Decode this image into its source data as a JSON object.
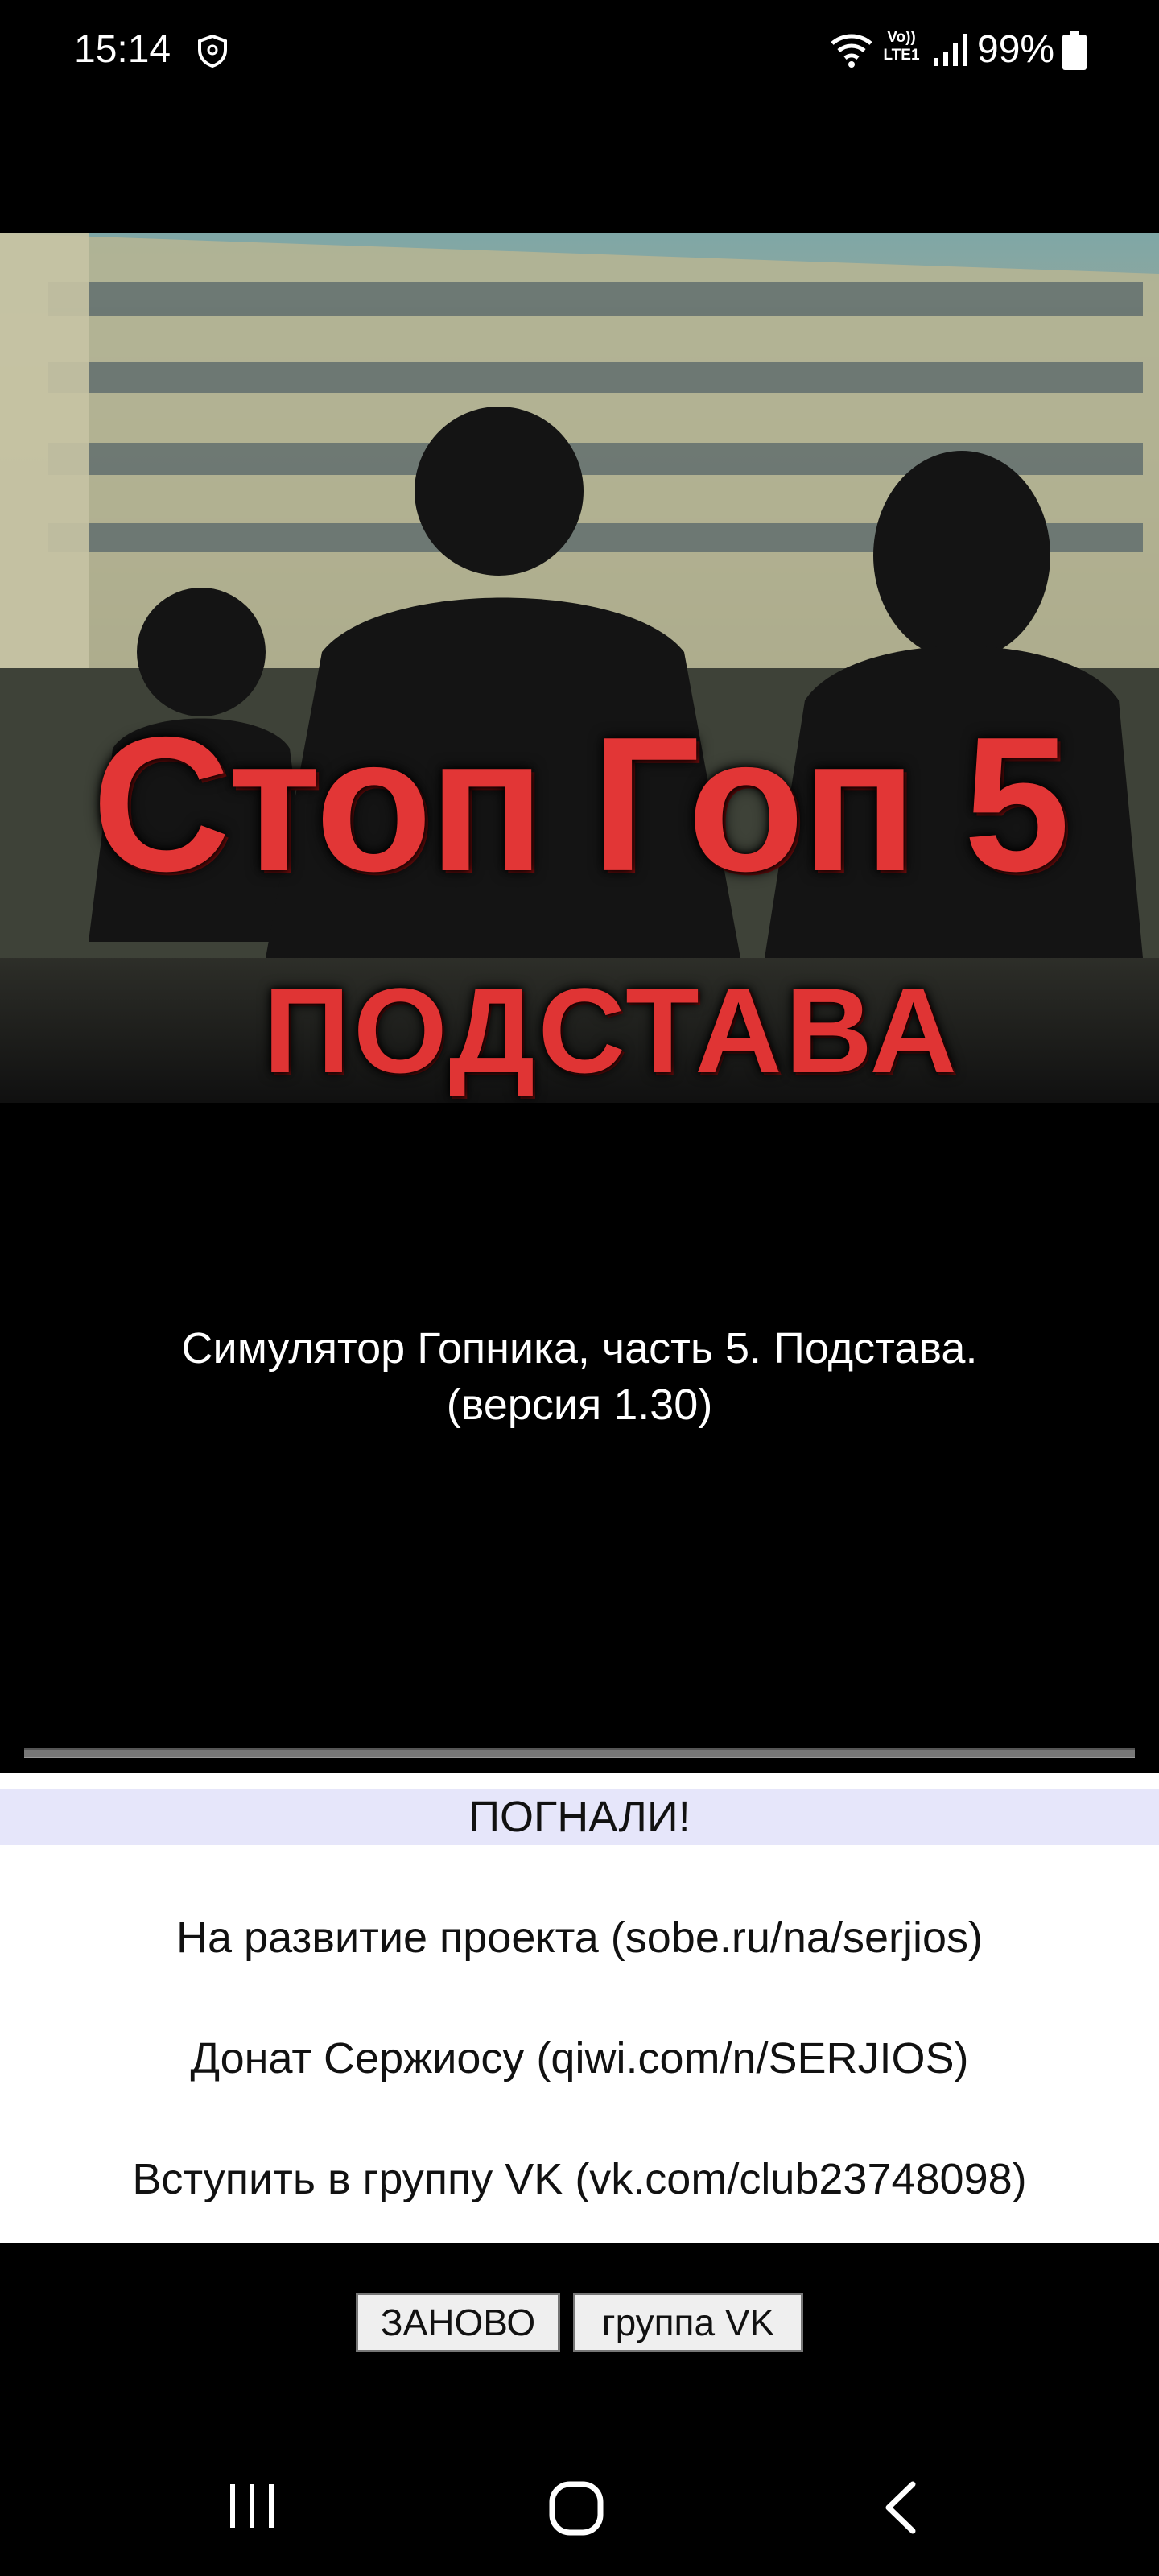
{
  "status_bar": {
    "time": "15:14",
    "network_label": "Vo)) LTE1",
    "battery": "99%"
  },
  "banner": {
    "title": "Стоп Гоп 5",
    "subtitle": "ПОДСТАВА"
  },
  "description": {
    "line1": "Симулятор Гопника, часть 5. Подстава.",
    "line2": "(версия 1.30)"
  },
  "menu": {
    "start": "ПОГНАЛИ!",
    "items": [
      "На развитие проекта (sobe.ru/na/serjios)",
      "Донат Сержиосу (qiwi.com/n/SERJIOS)",
      "Вступить в группу VK (vk.com/club23748098)"
    ]
  },
  "buttons": {
    "restart": "ЗАНОВО",
    "vk_group": "группа VK"
  },
  "colors": {
    "accent_red": "#e23636",
    "start_highlight": "#e6e6fa",
    "background": "#000000"
  }
}
